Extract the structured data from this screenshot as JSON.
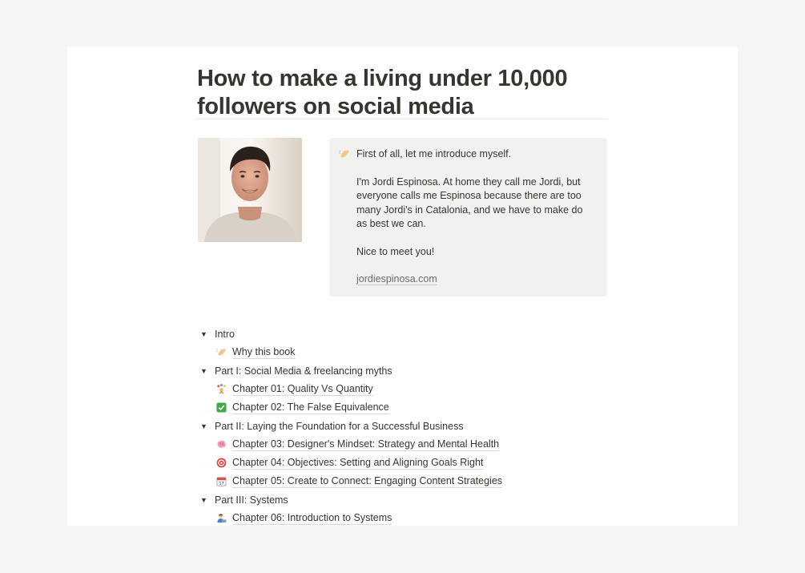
{
  "page": {
    "title": "How to make a living under 10,000 followers on social media"
  },
  "profile_photo": {
    "alt": "portrait photo"
  },
  "callout": {
    "icon": "waving-hand-icon",
    "paragraphs": [
      "First of all, let me introduce myself.",
      "I'm Jordi Espinosa. At home they call me Jordi, but everyone calls me Espinosa because there are too many Jordi's in Catalonia, and we have to make do as best we can.",
      "Nice to meet you!"
    ],
    "link": "jordiespinosa.com"
  },
  "toc": {
    "sections": [
      {
        "label": "Intro",
        "items": [
          {
            "icon": "waving-hand-icon",
            "label": "Why this book"
          }
        ]
      },
      {
        "label": "Part I: Social Media & freelancing myths",
        "items": [
          {
            "icon": "juggling-icon",
            "label": "Chapter 01: Quality Vs Quantity"
          },
          {
            "icon": "check-mark-icon",
            "label": "Chapter 02: The False Equivalence"
          }
        ]
      },
      {
        "label": "Part II: Laying the Foundation for a Successful Business",
        "items": [
          {
            "icon": "brain-icon",
            "label": "Chapter 03: Designer's Mindset: Strategy and Mental Health"
          },
          {
            "icon": "target-icon",
            "label": "Chapter 04: Objectives: Setting and Aligning Goals Right"
          },
          {
            "icon": "calendar-icon",
            "label": "Chapter 05: Create to Connect: Engaging Content Strategies"
          }
        ]
      },
      {
        "label": "Part III: Systems",
        "items": [
          {
            "icon": "technologist-icon",
            "label": "Chapter 06: Introduction to Systems"
          }
        ]
      }
    ]
  },
  "colors": {
    "background": "#f5f5f4",
    "page": "#ffffff",
    "callout_bg": "#f1f1ef",
    "text": "#37352f"
  }
}
